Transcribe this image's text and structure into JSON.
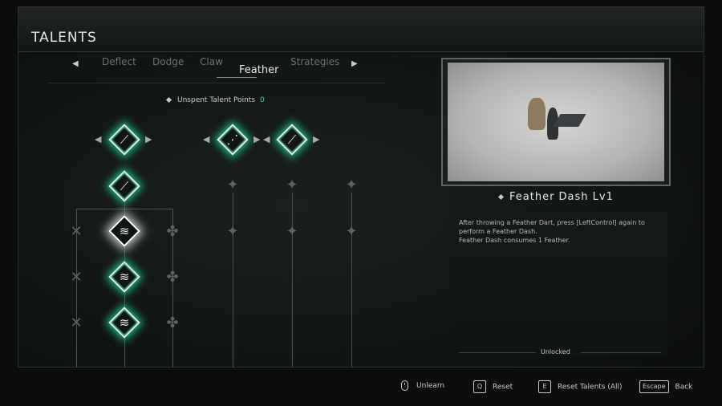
{
  "header": {
    "title": "TALENTS"
  },
  "tabs": [
    {
      "label": "Deflect"
    },
    {
      "label": "Dodge"
    },
    {
      "label": "Claw"
    },
    {
      "label": "Feather"
    },
    {
      "label": "Strategies"
    }
  ],
  "active_tab": "Feather",
  "talent_points": {
    "label": "Unspent Talent Points",
    "value": "0"
  },
  "skill": {
    "name": "Feather Dash Lv1",
    "description_line1": "After throwing a Feather Dart, press [LeftControl] again to",
    "description_line2": "perform a Feather Dash.",
    "description_line3": "Feather Dash consumes 1 Feather.",
    "status": "Unlocked"
  },
  "footer": {
    "unlearn": "Unlearn",
    "reset_key": "Q",
    "reset": "Reset",
    "reset_all_key": "E",
    "reset_all": "Reset Talents (All)",
    "back_key": "Escape",
    "back": "Back"
  },
  "colors": {
    "accent": "#1eb07f",
    "points_value": "#3fd6a6"
  }
}
